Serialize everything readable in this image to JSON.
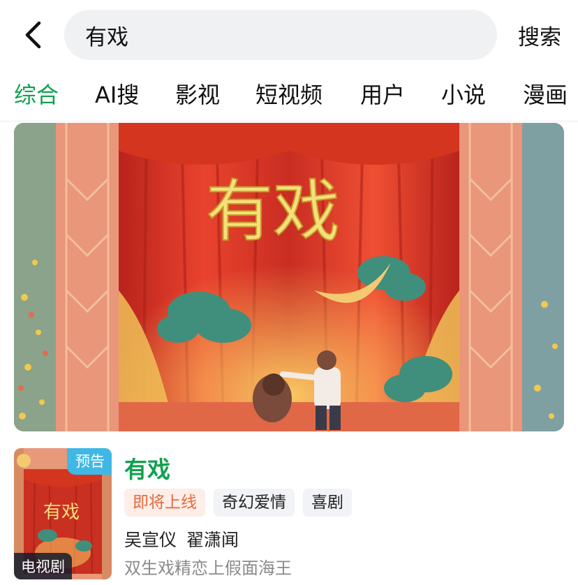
{
  "header": {
    "search_query": "有戏",
    "search_button": "搜索"
  },
  "tabs": [
    {
      "label": "综合",
      "active": true
    },
    {
      "label": "AI搜",
      "active": false
    },
    {
      "label": "影视",
      "active": false
    },
    {
      "label": "短视频",
      "active": false
    },
    {
      "label": "用户",
      "active": false
    },
    {
      "label": "小说",
      "active": false
    },
    {
      "label": "漫画",
      "active": false
    }
  ],
  "banner": {
    "title_art": "有戏"
  },
  "result": {
    "title": "有戏",
    "poster_badge": "预告",
    "poster_type": "电视剧",
    "poster_art_title": "有戏",
    "tags": [
      "即将上线",
      "奇幻爱情",
      "喜剧"
    ],
    "cast": "吴宣仪  翟潇闻",
    "description": "双生戏精恋上假面海王"
  },
  "colors": {
    "accent_green": "#12a150",
    "status_orange": "#e46a3f",
    "badge_blue": "#3fb8e6"
  },
  "icons": {
    "back": "chevron-left-icon"
  }
}
